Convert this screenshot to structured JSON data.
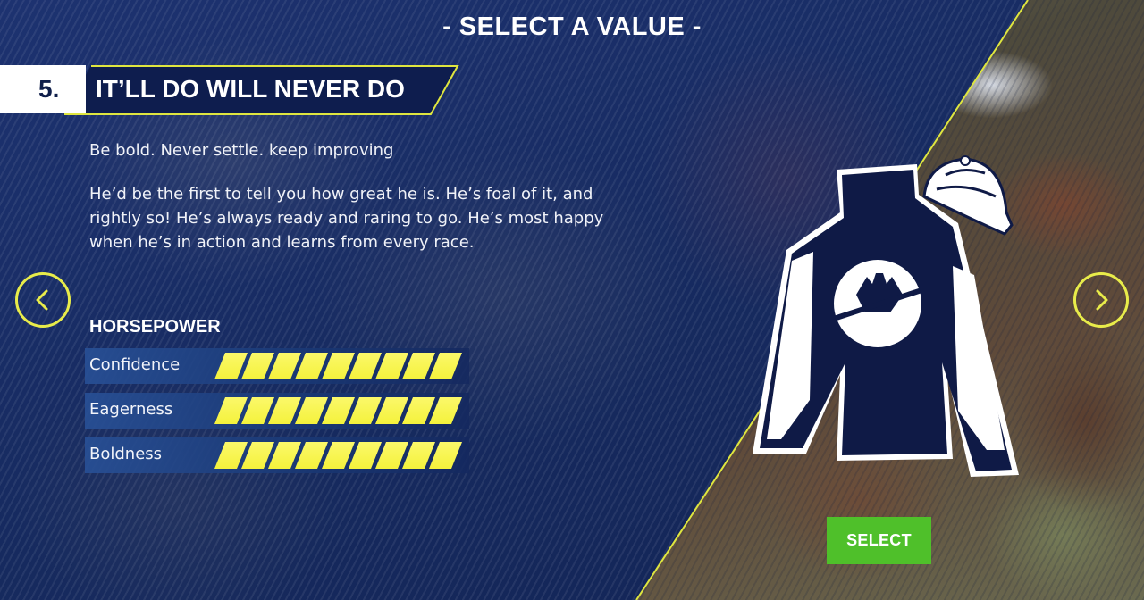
{
  "header": {
    "title": "- SELECT A VALUE -"
  },
  "value": {
    "number": "5.",
    "name": "IT’LL DO WILL NEVER DO",
    "motto": "Be bold. Never settle. keep improving",
    "description": "He’d be the first to tell you how great he is. He’s foal of it, and rightly so! He’s always ready and raring to go. He’s most happy when he’s in action and learns from every race."
  },
  "horsepower": {
    "heading": "HORSEPOWER",
    "stats": [
      {
        "label": "Confidence",
        "level": 9,
        "max": 9
      },
      {
        "label": "Eagerness",
        "level": 9,
        "max": 9
      },
      {
        "label": "Boldness",
        "level": 9,
        "max": 9
      }
    ]
  },
  "navigation": {
    "prev_icon": "chevron-left-icon",
    "next_icon": "chevron-right-icon"
  },
  "silks": {
    "icon": "jockey-silks-icon",
    "cap_icon": "jockey-cap-icon"
  },
  "actions": {
    "select_label": "SELECT"
  },
  "colors": {
    "background": "#17295c",
    "banner": "#0e1d4e",
    "accent_yellow": "#e8ec4a",
    "bar_yellow": "#f4f23c",
    "select_green": "#4fc02a",
    "silks_navy": "#0f1a46"
  }
}
